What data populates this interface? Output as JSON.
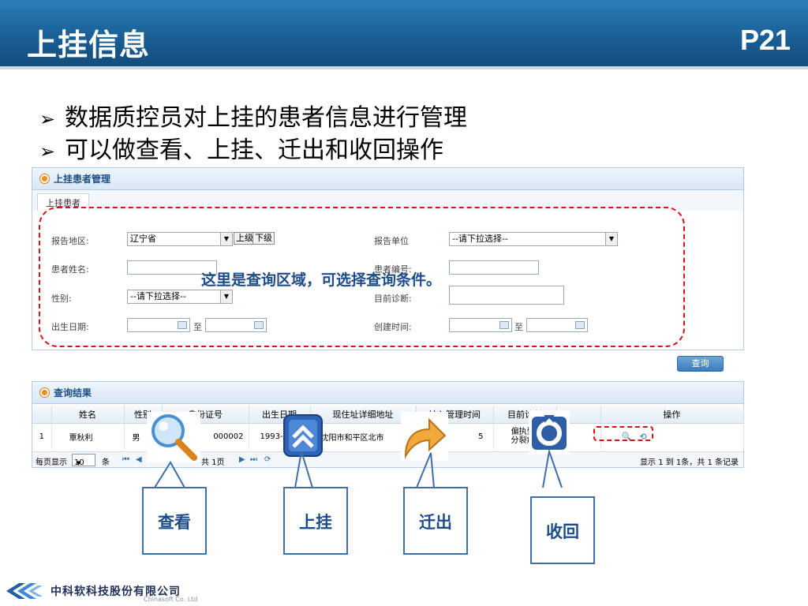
{
  "slide": {
    "title": "上挂信息",
    "page_number": "P21",
    "bullets": [
      "数据质控员对上挂的患者信息进行管理",
      "可以做查看、上挂、迁出和收回操作"
    ],
    "bullet_marker": "➢"
  },
  "query_panel": {
    "header": "上挂患者管理",
    "tab": "上挂患者",
    "fields": {
      "region_label": "报告地区:",
      "region_value": "辽宁省",
      "btn_upper": "上级",
      "btn_lower": "下级",
      "unit_label": "报告单位",
      "unit_value": "--请下拉选择--",
      "name_label": "患者姓名:",
      "name_value": "",
      "patient_no_label": "患者编号:",
      "patient_no_value": "",
      "gender_label": "性别:",
      "gender_value": "--请下拉选择--",
      "diagnosis_label": "目前诊断:",
      "diagnosis_value": "",
      "birth_label": "出生日期:",
      "to_text": "至",
      "created_label": "创建时间:"
    },
    "query_button": "查询"
  },
  "annotation": "这里是查询区域，可选择查询条件。",
  "result_panel": {
    "header": "查询结果",
    "columns": [
      "",
      "姓名",
      "性别",
      "身份证号",
      "出生日期",
      "现住址详细地址",
      "纳入管理时间",
      "目前诊断",
      "",
      "操作"
    ],
    "rows": [
      {
        "index": "1",
        "name": "覃秋利",
        "gender": "男",
        "id_no": "000002",
        "birth": "1993-09-18",
        "address": "省沈阳市和平区北市",
        "managed_time": "5",
        "diagnosis": "偏执型精神分裂症"
      }
    ],
    "pager": {
      "per_page_label": "每页显示",
      "per_page_value": "10",
      "unit": "条",
      "total_pages": "共 1页",
      "summary": "显示 1 到 1条，共 1 条记录"
    }
  },
  "callouts": {
    "view": "查看",
    "upgrade": "上挂",
    "move_out": "迁出",
    "recall": "收回"
  },
  "icons": {
    "view": "magnifier-icon",
    "upgrade": "double-up-arrow-icon",
    "move_out": "curved-arrow-icon",
    "recall": "recall-icon"
  },
  "footer": {
    "company_cn": "中科软科技股份有限公司",
    "company_en": "Chinasoft Co. Ltd"
  },
  "colors": {
    "title_bar": "#1a5f96",
    "annotation_text": "#1d4c8a",
    "dashed_border": "#d8121b",
    "callout_border": "#3f6ea8"
  }
}
